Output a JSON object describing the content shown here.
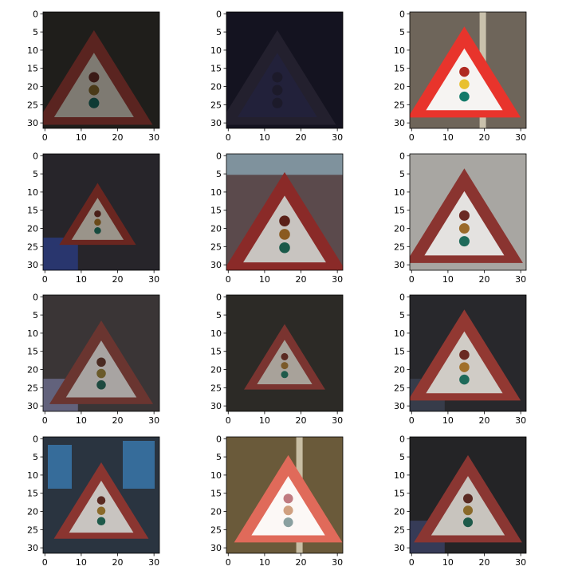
{
  "figure": {
    "rows": 4,
    "cols": 3,
    "image_size": [
      32,
      32
    ],
    "x_ticks": [
      "0",
      "10",
      "20",
      "30"
    ],
    "y_ticks": [
      "0",
      "5",
      "10",
      "15",
      "20",
      "25",
      "30"
    ],
    "subject": "traffic-signals-ahead-warning-sign"
  },
  "panels": [
    {
      "bg": "#1f1e1b",
      "tri": "#5a2420",
      "inner": "#7e7a72",
      "lights": [
        "#3a1a16",
        "#4a3a18",
        "#0e3a34"
      ],
      "tri_pos": [
        14,
        5,
        31
      ],
      "dark": 0.0
    },
    {
      "bg": "#141320",
      "tri": "#23202e",
      "inner": "#22213a",
      "lights": [
        "#1c1a2a",
        "#1c1a2a",
        "#1c1a2a"
      ],
      "tri_pos": [
        14,
        5,
        31
      ],
      "dark": 0.0
    },
    {
      "bg": "#6e655a",
      "tri": "#e8342c",
      "inner": "#f6f4f2",
      "lights": [
        "#b02a22",
        "#e8c030",
        "#127a6a"
      ],
      "tri_pos": [
        15,
        4,
        29
      ],
      "dark": 0.0,
      "post": true
    },
    {
      "bg": "#27252a",
      "tri": "#6a2620",
      "inner": "#9a948a",
      "lights": [
        "#4a2018",
        "#6a4a1a",
        "#154a3e"
      ],
      "tri_pos": [
        15,
        8,
        25
      ],
      "dark": 0.0,
      "car": "#2a3a7a"
    },
    {
      "bg": "#5b4a4c",
      "tri": "#8a2a28",
      "inner": "#c8c4c0",
      "lights": [
        "#5a2018",
        "#8a5a20",
        "#1a5a4a"
      ],
      "tri_pos": [
        16,
        5,
        32
      ],
      "dark": 0.0,
      "sky": "#8fb0c0"
    },
    {
      "bg": "#a8a6a2",
      "tri": "#8a3430",
      "inner": "#e4e2e0",
      "lights": [
        "#6a2a24",
        "#9a6a2a",
        "#1e6a5a"
      ],
      "tri_pos": [
        15,
        4,
        30
      ],
      "dark": 0.0
    },
    {
      "bg": "#3a3536",
      "tri": "#6a3530",
      "inner": "#a8a4a2",
      "lights": [
        "#4a2a22",
        "#6a5a2a",
        "#1e4a40"
      ],
      "tri_pos": [
        16,
        7,
        30
      ],
      "dark": 0.0,
      "car": "#6a6a88"
    },
    {
      "bg": "#2c2a26",
      "tri": "#7a3430",
      "inner": "#a8a29a",
      "lights": [
        "#5a2a22",
        "#7a5a2a",
        "#1e5a4a"
      ],
      "tri_pos": [
        16,
        8,
        26
      ],
      "dark": 0.0
    },
    {
      "bg": "#28282c",
      "tri": "#923832",
      "inner": "#d0ccc6",
      "lights": [
        "#6a2a22",
        "#a0702a",
        "#1e6a5a"
      ],
      "tri_pos": [
        15,
        4,
        29
      ],
      "dark": 0.0,
      "car": "#3a4050"
    },
    {
      "bg": "#2a3440",
      "tri": "#8a3530",
      "inner": "#c8c4c0",
      "lights": [
        "#5a2a22",
        "#8a6a2a",
        "#1e5a4a"
      ],
      "tri_pos": [
        16,
        7,
        28
      ],
      "dark": 0.0,
      "windows": "#3a7ab0"
    },
    {
      "bg": "#6a5a3a",
      "tri": "#e06a5a",
      "inner": "#fcf8f6",
      "lights": [
        "#c07a80",
        "#d0a080",
        "#8aa0a0"
      ],
      "tri_pos": [
        17,
        5,
        29
      ],
      "dark": 0.0,
      "post": true
    },
    {
      "bg": "#242426",
      "tri": "#8a3632",
      "inner": "#c8c4be",
      "lights": [
        "#5a2a22",
        "#8a6a2a",
        "#1e5a4a"
      ],
      "tri_pos": [
        16,
        5,
        29
      ],
      "dark": 0.0,
      "car": "#3a4060"
    }
  ]
}
